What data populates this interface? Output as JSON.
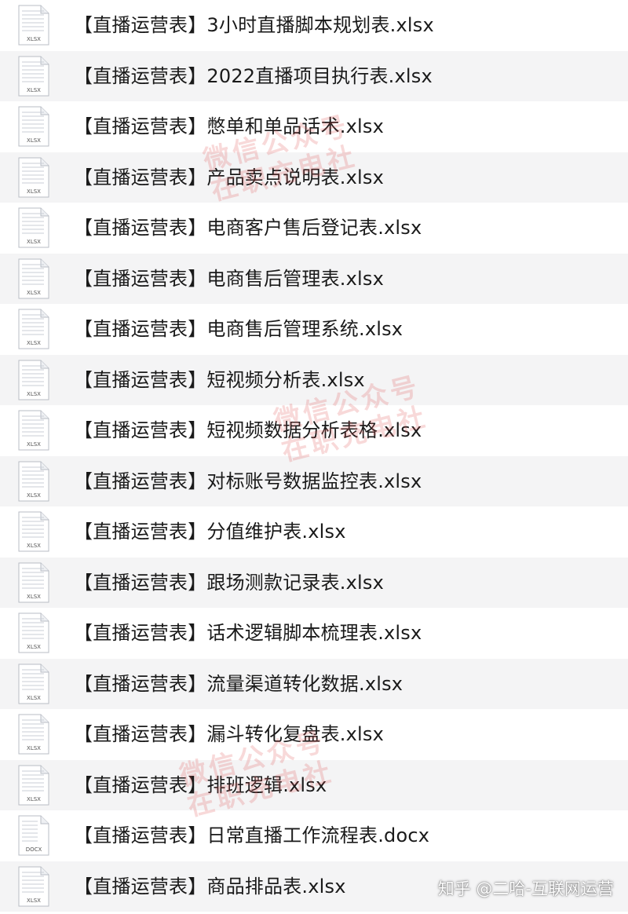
{
  "files": [
    {
      "name": "【直播运营表】3小时直播脚本规划表.xlsx",
      "icon": "xlsx-file-icon",
      "ext": "XLSX"
    },
    {
      "name": "【直播运营表】2022直播项目执行表.xlsx",
      "icon": "xlsx-file-icon",
      "ext": "XLSX"
    },
    {
      "name": "【直播运营表】憋单和单品话术.xlsx",
      "icon": "xlsx-file-icon",
      "ext": "XLSX"
    },
    {
      "name": "【直播运营表】产品卖点说明表.xlsx",
      "icon": "xlsx-file-icon",
      "ext": "XLSX"
    },
    {
      "name": "【直播运营表】电商客户售后登记表.xlsx",
      "icon": "xlsx-file-icon",
      "ext": "XLSX"
    },
    {
      "name": "【直播运营表】电商售后管理表.xlsx",
      "icon": "xlsx-file-icon",
      "ext": "XLSX"
    },
    {
      "name": "【直播运营表】电商售后管理系统.xlsx",
      "icon": "xlsx-file-icon",
      "ext": "XLSX"
    },
    {
      "name": "【直播运营表】短视频分析表.xlsx",
      "icon": "xlsx-file-icon",
      "ext": "XLSX"
    },
    {
      "name": "【直播运营表】短视频数据分析表格.xlsx",
      "icon": "xlsx-file-icon",
      "ext": "XLSX"
    },
    {
      "name": "【直播运营表】对标账号数据监控表.xlsx",
      "icon": "xlsx-file-icon",
      "ext": "XLSX"
    },
    {
      "name": "【直播运营表】分值维护表.xlsx",
      "icon": "xlsx-file-icon",
      "ext": "XLSX"
    },
    {
      "name": "【直播运营表】跟场测款记录表.xlsx",
      "icon": "xlsx-file-icon",
      "ext": "XLSX"
    },
    {
      "name": "【直播运营表】话术逻辑脚本梳理表.xlsx",
      "icon": "xlsx-file-icon",
      "ext": "XLSX"
    },
    {
      "name": "【直播运营表】流量渠道转化数据.xlsx",
      "icon": "xlsx-file-icon",
      "ext": "XLSX"
    },
    {
      "name": "【直播运营表】漏斗转化复盘表.xlsx",
      "icon": "xlsx-file-icon",
      "ext": "XLSX"
    },
    {
      "name": "【直播运营表】排班逻辑.xlsx",
      "icon": "xlsx-file-icon",
      "ext": "XLSX"
    },
    {
      "name": "【直播运营表】日常直播工作流程表.docx",
      "icon": "docx-file-icon",
      "ext": "DOCX"
    },
    {
      "name": "【直播运营表】商品排品表.xlsx",
      "icon": "xlsx-file-icon",
      "ext": "XLSX"
    }
  ],
  "watermark": {
    "line1": "微信公众号",
    "line2": "在职充电社"
  },
  "credit": "知乎 @二哈-互联网运营",
  "colors": {
    "alt_row": "#f4f4f5",
    "text": "#1a1a1a",
    "watermark": "#de5050"
  }
}
